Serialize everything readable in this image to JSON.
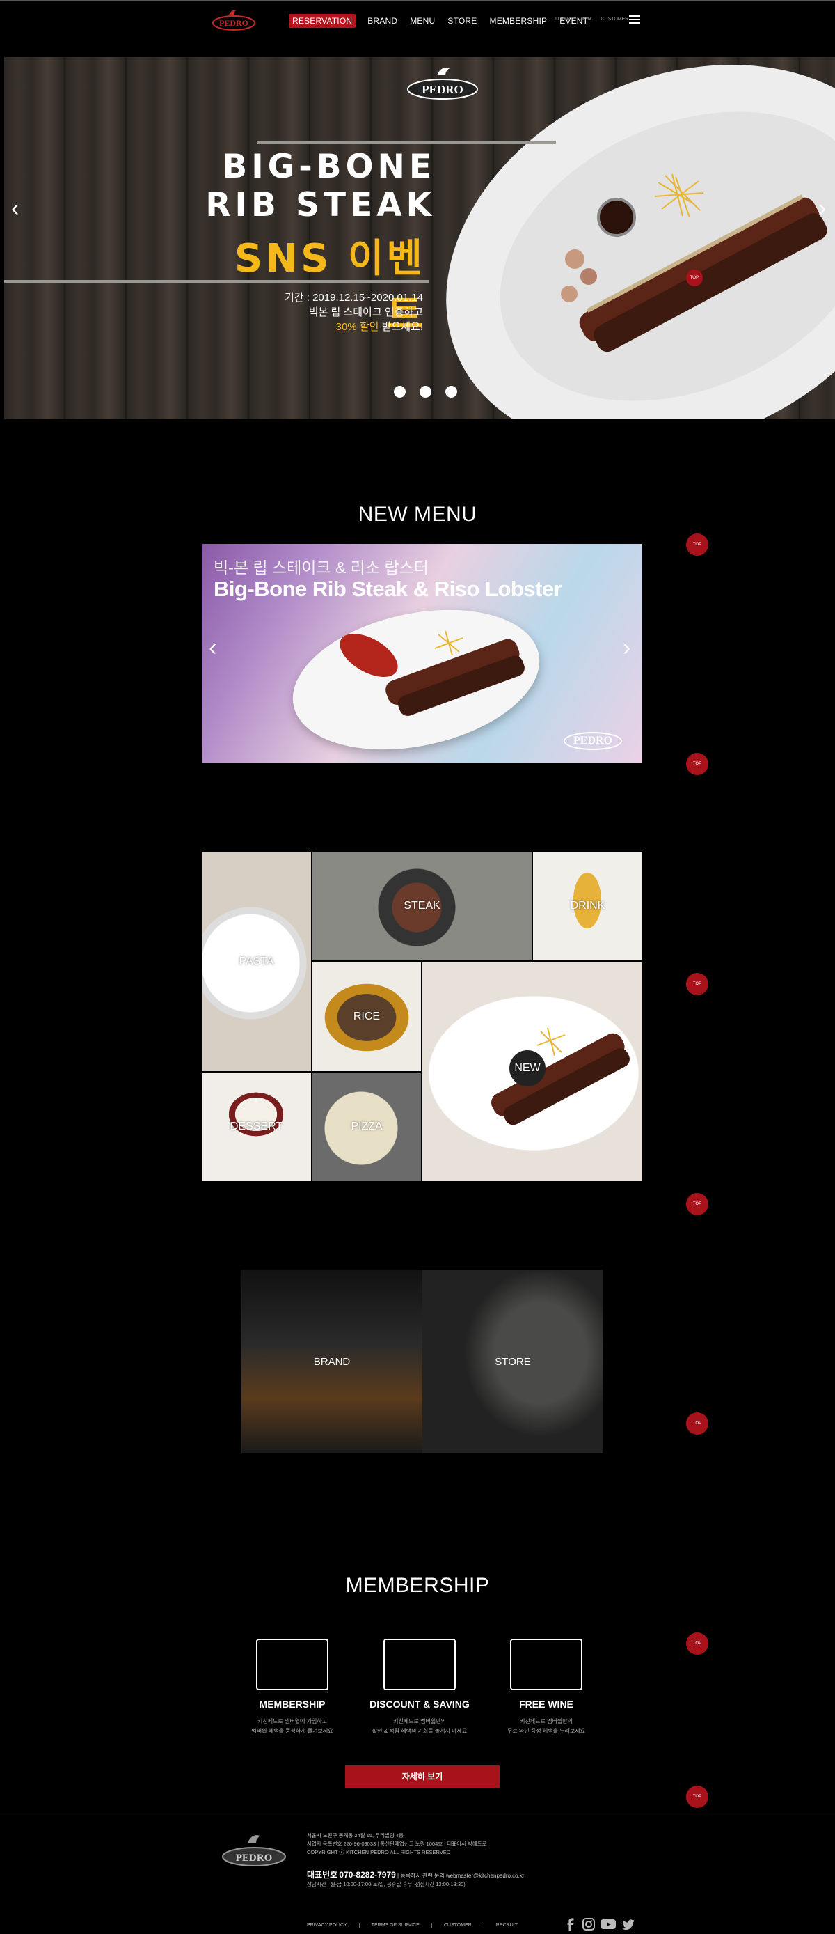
{
  "header": {
    "logo": "PEDRO",
    "nav": [
      "RESERVATION",
      "BRAND",
      "MENU",
      "STORE",
      "MEMBERSHIP",
      "EVENT"
    ],
    "util": [
      "LOGIN",
      "JOIN",
      "CUSTOMER"
    ]
  },
  "hero": {
    "logo": "PEDRO",
    "title_line1": "BIG-BONE",
    "title_line2": "RIB STEAK",
    "sns": "SNS 이벤트",
    "period": "기간 : 2019.12.15~2020.01.14",
    "line2": "빅본 립 스테이크 인증하고",
    "discount": "30% 할인",
    "line3_suffix": " 받으세요!",
    "badge": "TOP",
    "slides_total": 3
  },
  "top_label": "TOP",
  "new_menu": {
    "title": "NEW MENU",
    "name_ko": "빅-본 립 스테이크 & 리소 랍스터",
    "name_en": "Big-Bone Rib Steak & Riso Lobster",
    "logo": "PEDRO"
  },
  "menu_grid": {
    "pasta": "PASTA",
    "steak": "STEAK",
    "drink": "DRINK",
    "rice": "RICE",
    "new": "NEW",
    "dessert": "DESSERT",
    "pizza": "PIZZA"
  },
  "brand_store": {
    "brand": "BRAND",
    "store": "STORE"
  },
  "membership": {
    "title": "MEMBERSHIP",
    "items": [
      {
        "title": "MEMBERSHIP",
        "desc1": "키친페드로 멤버쉽에 가입하고",
        "desc2": "멤버쉽 혜택을 풍성하게 즐겨보세요"
      },
      {
        "title": "DISCOUNT & SAVING",
        "desc1": "키친페드로 멤버쉽만의",
        "desc2": "할인 & 적립 혜택의 기회를 놓치지 마세요"
      },
      {
        "title": "FREE WINE",
        "desc1": "키친페드로 멤버쉽만의",
        "desc2": "무료 와인 증정 혜택을 누려보세요"
      }
    ],
    "button": "자세히 보기"
  },
  "footer": {
    "logo": "PEDRO",
    "address": "서울시 노원구 동계동 24길 15, 우리빌딩 4층",
    "biz": "사업자 등록번호 220-96-09033 | 통신판매업신고 노원 1004호 | 대표이사 박혜드로",
    "copyright": "COPYRIGHT ⓒ KITCHEN PEDRO ALL RIGHTS RESERVED",
    "tel_label": "대표번호",
    "tel": "070-8282-7979",
    "contact": " | 등록하시 관련 문의 webmaster@kitchenpedro.co.kr",
    "hours": "상담시간 : 월-금 10:00-17:00(토/일, 공휴일 휴무, 점심시간 12:00-13:30)",
    "links": [
      "PRIVACY POLICY",
      "TERMS OF SURVICE",
      "CUSTOMER",
      "RECRUIT"
    ],
    "social": [
      "facebook-icon",
      "instagram-icon",
      "youtube-icon",
      "twitter-icon"
    ]
  }
}
